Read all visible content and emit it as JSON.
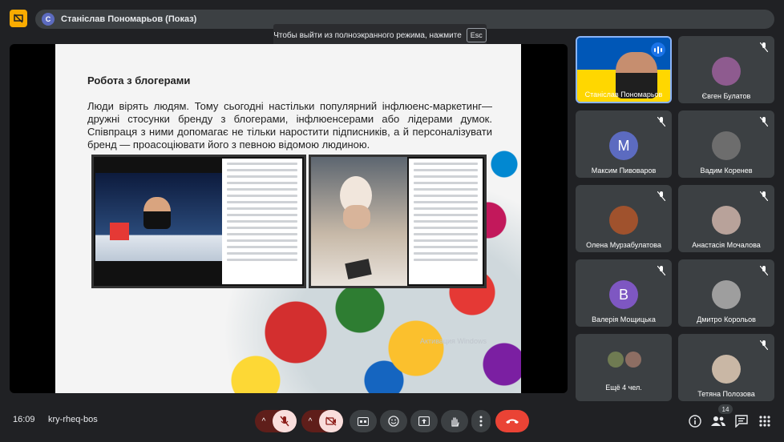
{
  "presenter": {
    "initial": "С",
    "label": "Станіслав Пономарьов (Показ)"
  },
  "toast": {
    "text": "Чтобы выйти из полноэкранного режима, нажмите",
    "key": "Esc"
  },
  "slide": {
    "title": "Робота з блогерами",
    "body": "Люди вірять людям. Тому сьогодні настільки популярний інфлюенс-маркетинг— дружні стосунки бренду з блогерами, інфлюенсерами або лідерами думок. Співпраця з ними допомагає не тільки наростити підписників, а й персоналізувати бренд — проасоціювати його з певною відомою людиною.",
    "watermark": "Активация Windows"
  },
  "participants": [
    {
      "name": "Станіслав Пономарьов",
      "speaking": true
    },
    {
      "name": "Євген Булатов",
      "color": "#8e5b8f"
    },
    {
      "name": "Максим Пивоваров",
      "initial": "М",
      "color": "#5c6bc0"
    },
    {
      "name": "Вадим Коренев",
      "color": "#6d6d6d"
    },
    {
      "name": "Олена Мурзабулатова",
      "color": "#a0522d"
    },
    {
      "name": "Анастасія Мочалова",
      "color": "#b8a29a"
    },
    {
      "name": "Валерія Мощицька",
      "initial": "В",
      "color": "#7e57c2"
    },
    {
      "name": "Дмитро Корольов",
      "color": "#9e9e9e"
    },
    {
      "name": "Ещё 4 чел.",
      "color": "#6f7b52"
    },
    {
      "name": "Тетяна Полозова",
      "color": "#c9b7a5"
    }
  ],
  "bottom": {
    "time": "16:09",
    "meeting_code": "kry-rheq-bos",
    "participant_count": "14"
  }
}
